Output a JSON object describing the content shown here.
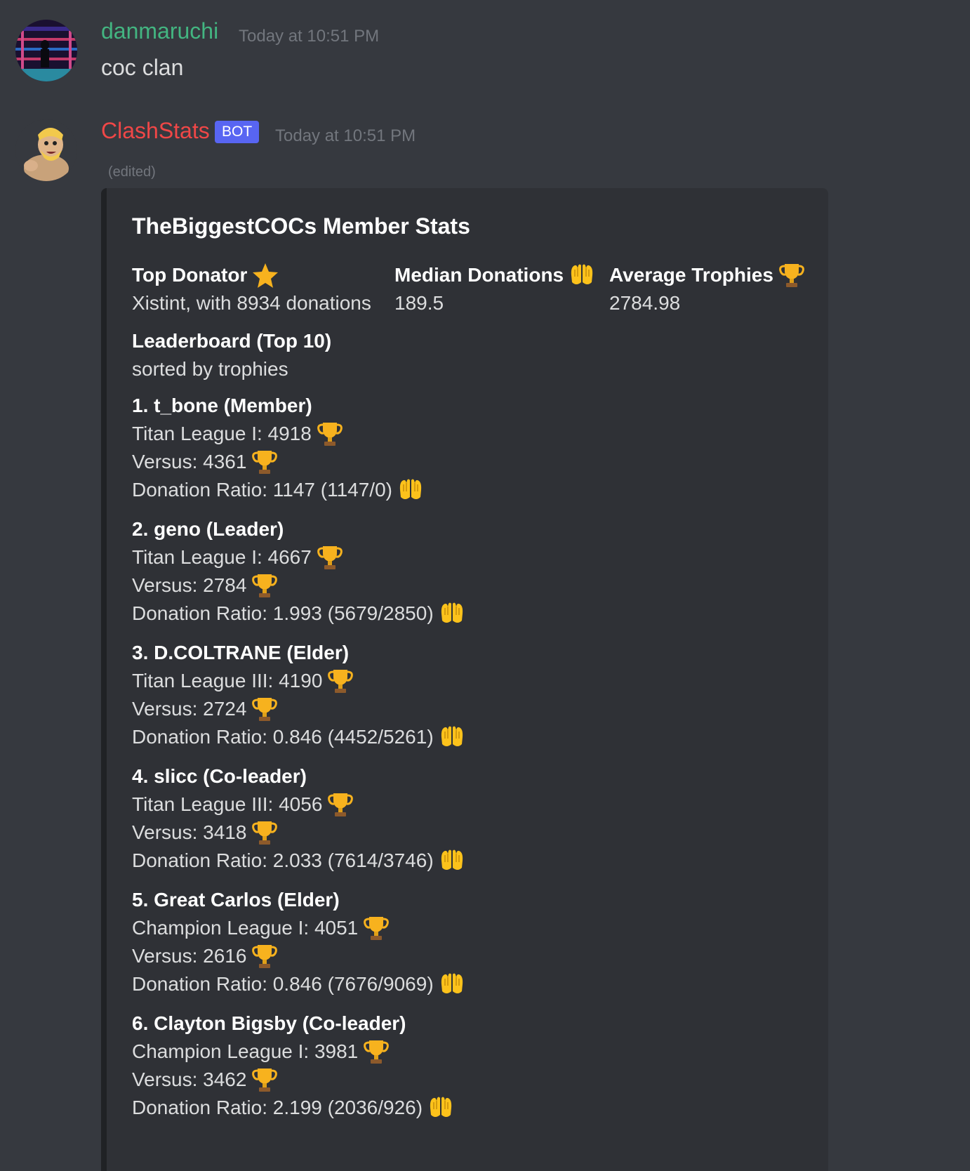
{
  "messages": [
    {
      "author": "danmaruchi",
      "author_color": "#43b581",
      "timestamp": "Today at 10:51 PM",
      "content": "coc clan"
    },
    {
      "author": "ClashStats",
      "author_color": "#f04747",
      "bot_tag": "BOT",
      "timestamp": "Today at 10:51 PM",
      "edited_label": "(edited)",
      "embed": {
        "title": "TheBiggestCOCs Member Stats",
        "stats": [
          {
            "name": "Top Donator",
            "value": "Xistint, with 8934 donations",
            "icon": "star-icon"
          },
          {
            "name": "Median Donations",
            "value": "189.5",
            "icon": "raised-hands-icon"
          },
          {
            "name": "Average Trophies",
            "value": "2784.98",
            "icon": "trophy-icon"
          }
        ],
        "leaderboard": {
          "name": "Leaderboard (Top 10)",
          "subtitle": "sorted by trophies"
        },
        "members": [
          {
            "title": "1. t_bone (Member)",
            "league": "Titan League I: 4918",
            "versus": "Versus: 4361",
            "donation": "Donation Ratio: 1147 (1147/0)"
          },
          {
            "title": "2. geno (Leader)",
            "league": "Titan League I: 4667",
            "versus": "Versus: 2784",
            "donation": "Donation Ratio: 1.993 (5679/2850)"
          },
          {
            "title": "3. D.COLTRANE (Elder)",
            "league": "Titan League III: 4190",
            "versus": "Versus: 2724",
            "donation": "Donation Ratio: 0.846 (4452/5261)"
          },
          {
            "title": "4. slicc (Co-leader)",
            "league": "Titan League III: 4056",
            "versus": "Versus: 3418",
            "donation": "Donation Ratio: 2.033 (7614/3746)"
          },
          {
            "title": "5. Great Carlos (Elder)",
            "league": "Champion League I: 4051",
            "versus": "Versus: 2616",
            "donation": "Donation Ratio: 0.846 (7676/9069)"
          },
          {
            "title": "6. Clayton Bigsby (Co-leader)",
            "league": "Champion League I: 3981",
            "versus": "Versus: 3462",
            "donation": "Donation Ratio: 2.199 (2036/926)"
          }
        ]
      }
    }
  ]
}
